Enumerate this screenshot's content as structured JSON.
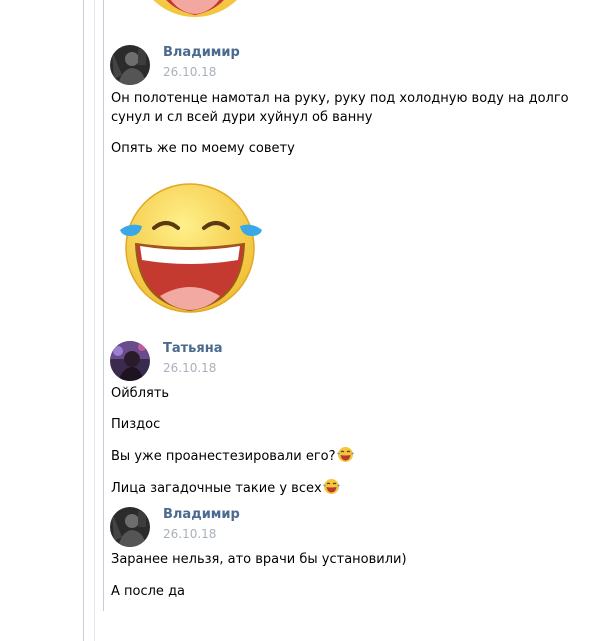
{
  "messages": [
    {
      "author": "Владимир",
      "date": "26.10.18",
      "lines": [
        "Он полотенце намотал на руку, руку под холодную воду на долго",
        "сунул и сл всей дури хуйнул об ванну",
        "Опять же по моему совету"
      ]
    },
    {
      "author": "Татьяна",
      "date": "26.10.18",
      "lines": [
        "Ойблять",
        "Пиздос",
        "Вы уже проанестезировали его?",
        "Лица загадочные такие у всех"
      ]
    },
    {
      "author": "Владимир",
      "date": "26.10.18",
      "lines": [
        "Заранее нельзя, ато врачи бы установили)",
        "А после да"
      ]
    }
  ],
  "colors": {
    "author_link": "#4a6b8f",
    "date": "#a8b1bc",
    "thread_line": "#c5ced8",
    "sticker_face": "#f5cc3c",
    "tear": "#3aa7e6"
  },
  "icons": {
    "sticker": "laughing-tears-sticker",
    "inline_emoji": "face-with-tears-of-joy-emoji"
  }
}
